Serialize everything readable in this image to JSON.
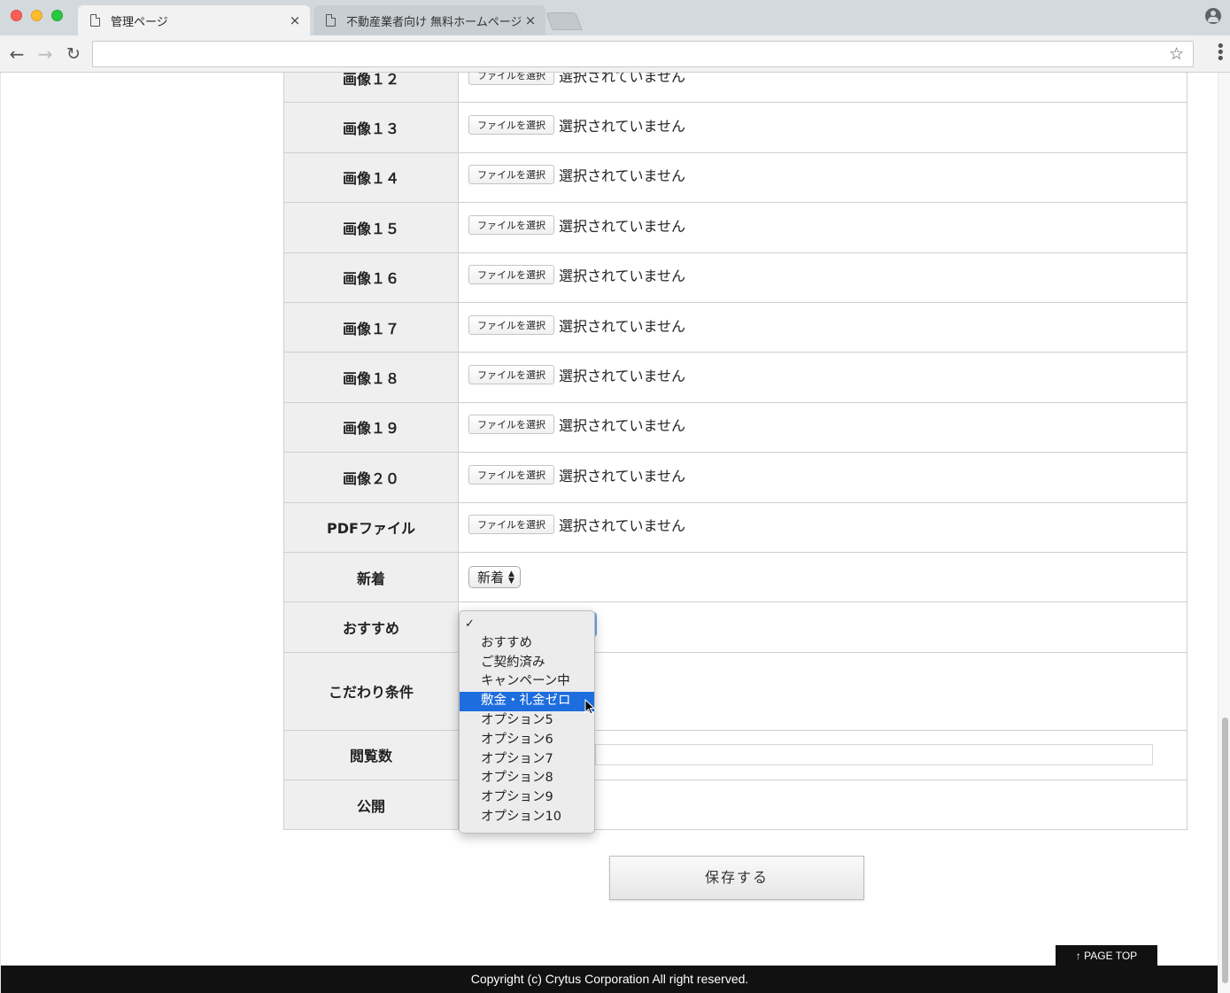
{
  "browser": {
    "tabs": [
      {
        "title": "管理ページ",
        "close": "×"
      },
      {
        "title": "不動産業者向け 無料ホームページ",
        "close": "×"
      }
    ],
    "nav": {
      "back": "←",
      "forward": "→",
      "reload": "↻",
      "star": "☆",
      "menu": "⋮"
    }
  },
  "form": {
    "file_button_label": "ファイルを選択",
    "file_status": "選択されていません",
    "file_rows": [
      {
        "label": "画像１２"
      },
      {
        "label": "画像１３"
      },
      {
        "label": "画像１４"
      },
      {
        "label": "画像１５"
      },
      {
        "label": "画像１６"
      },
      {
        "label": "画像１７"
      },
      {
        "label": "画像１８"
      },
      {
        "label": "画像１９"
      },
      {
        "label": "画像２０"
      },
      {
        "label": "PDFファイル"
      }
    ],
    "shinchaku": {
      "label": "新着",
      "value": "新着"
    },
    "osusume": {
      "label": "おすすめ"
    },
    "kodawari": {
      "label": "こだわり条件"
    },
    "views": {
      "label": "閲覧数"
    },
    "publish": {
      "label": "公開"
    }
  },
  "dropdown": {
    "options": [
      "",
      "おすすめ",
      "ご契約済み",
      "キャンペーン中",
      "敷金・礼金ゼロ",
      "オプション5",
      "オプション6",
      "オプション7",
      "オプション8",
      "オプション9",
      "オプション10"
    ],
    "checked_index": 0,
    "highlight_index": 4
  },
  "save_button": "保存する",
  "page_top": "↑ PAGE TOP",
  "footer": "Copyright (c) Crytus Corporation All right reserved."
}
